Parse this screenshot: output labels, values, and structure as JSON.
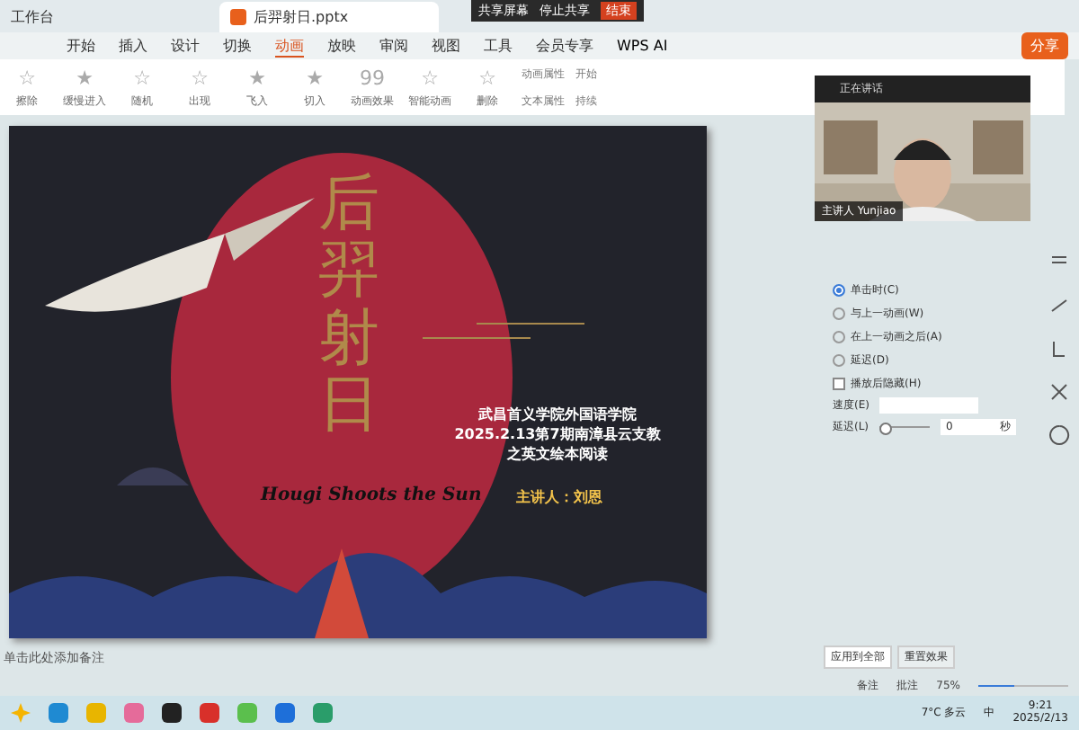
{
  "doc_tabs": [
    {
      "label": "工作台",
      "selected": false
    },
    {
      "label": "后羿射日.pptx",
      "selected": true
    }
  ],
  "meeting_bar": {
    "share": "共享屏幕",
    "record": "停止共享",
    "end": "结束"
  },
  "menu": [
    {
      "label": "开始",
      "selected": false
    },
    {
      "label": "插入",
      "selected": false
    },
    {
      "label": "设计",
      "selected": false
    },
    {
      "label": "切换",
      "selected": false
    },
    {
      "label": "动画",
      "selected": true
    },
    {
      "label": "放映",
      "selected": false
    },
    {
      "label": "审阅",
      "selected": false
    },
    {
      "label": "视图",
      "selected": false
    },
    {
      "label": "工具",
      "selected": false
    },
    {
      "label": "会员专享",
      "selected": false
    }
  ],
  "ai_label": "WPS AI",
  "share_button": "分享",
  "animations": [
    {
      "glyph": "☆",
      "label": "擦除"
    },
    {
      "glyph": "★",
      "label": "缓慢进入"
    },
    {
      "glyph": "☆",
      "label": "随机"
    },
    {
      "glyph": "☆",
      "label": "出现"
    },
    {
      "glyph": "★",
      "label": "飞入"
    },
    {
      "glyph": "★",
      "label": "切入"
    },
    {
      "glyph": "99",
      "label": "动画效果"
    },
    {
      "glyph": "☆",
      "label": "智能动画"
    },
    {
      "glyph": "☆",
      "label": "删除"
    }
  ],
  "ribbon_right": [
    "动画属性",
    "文本属性",
    "开始",
    "持续"
  ],
  "webcam": {
    "title": "正在讲话",
    "caption": "主讲人 Yunjiao"
  },
  "slide": {
    "title": "后羿射日",
    "subtitle_lines": [
      "武昌首义学院外国语学院",
      "2025.2.13第7期南漳县云支教",
      "之英文绘本阅读"
    ],
    "english": "Hougi Shoots the Sun",
    "speaker": "主讲人：刘恩"
  },
  "pane": {
    "options": [
      {
        "label": "单击时(C)",
        "selected": true
      },
      {
        "label": "与上一动画(W)",
        "selected": false
      },
      {
        "label": "在上一动画之后(A)",
        "selected": false
      },
      {
        "label": "延迟(D)",
        "selected": false
      }
    ],
    "checkbox": {
      "label": "播放后隐藏(H)",
      "checked": false
    },
    "speed_label": "速度(E)",
    "delay_label": "延迟(L)",
    "delay_value": "0",
    "delay_unit": "秒",
    "delay": {
      "level": 0.0
    }
  },
  "notes": "单击此处添加备注",
  "pane_buttons": [
    {
      "label": "应用到全部",
      "selected": true
    },
    {
      "label": "重置效果",
      "selected": false
    }
  ],
  "status": {
    "notes_btn": "备注",
    "comment_btn": "批注",
    "zoom": "75%"
  },
  "zoom": {
    "level": 0.4
  },
  "tray": {
    "weather": "7°C 多云",
    "ime": "中",
    "time": "9:21",
    "date": "2025/2/13"
  }
}
